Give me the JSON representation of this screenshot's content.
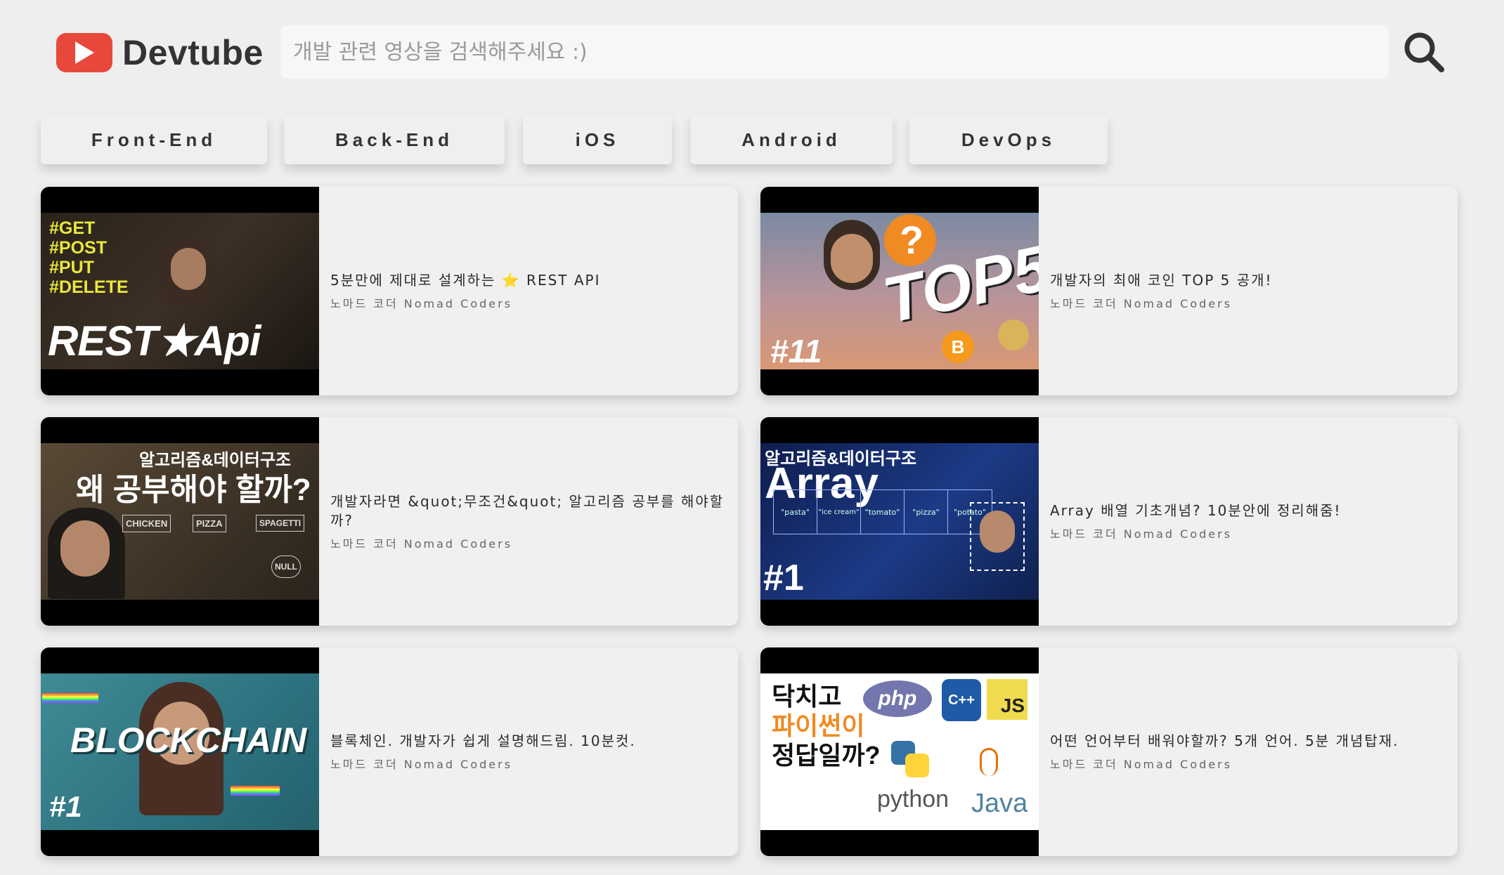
{
  "app": {
    "name": "Devtube"
  },
  "search": {
    "placeholder": "개발 관련 영상을 검색해주세요 :)",
    "value": ""
  },
  "categories": [
    "Front-End",
    "Back-End",
    "iOS",
    "Android",
    "DevOps"
  ],
  "videos": [
    {
      "title": "5분만에 제대로 설계하는 ⭐ REST API",
      "channel": "노마드 코더 Nomad Coders",
      "thumb_text": {
        "tags": "#GET\n#POST\n#PUT\n#DELETE",
        "main": "REST★Api"
      }
    },
    {
      "title": "개발자의 최애 코인 TOP 5 공개!",
      "channel": "노마드 코더 Nomad Coders",
      "thumb_text": {
        "main": "TOP5",
        "episode": "#11",
        "question": "?",
        "coin": "B"
      }
    },
    {
      "title": "개발자라면 &quot;무조건&quot; 알고리즘 공부를 해야할까?",
      "channel": "노마드 코더 Nomad Coders",
      "thumb_text": {
        "top": "알고리즘&데이터구조",
        "main": "왜 공부해야 할까?",
        "nodes": [
          "CHICKEN",
          "PIZZA",
          "SPAGETTI",
          "NULL"
        ]
      }
    },
    {
      "title": "Array 배열 기초개념? 10분안에 정리해줌!",
      "channel": "노마드 코더 Nomad Coders",
      "thumb_text": {
        "top": "알고리즘&데이터구조",
        "main": "Array",
        "cells": [
          "\"pasta\"",
          "\"ice cream\"",
          "\"tomato\"",
          "\"pizza\"",
          "\"potato\""
        ],
        "episode": "#1"
      }
    },
    {
      "title": "블록체인. 개발자가 쉽게 설명해드림. 10분컷.",
      "channel": "노마드 코더 Nomad Coders",
      "thumb_text": {
        "main": "BLOCKCHAIN",
        "episode": "#1"
      }
    },
    {
      "title": "어떤 언어부터 배워야할까? 5개 언어. 5분 개념탑재.",
      "channel": "노마드 코더 Nomad Coders",
      "thumb_text": {
        "line1": "닥치고",
        "line2": "파이썬이",
        "line3": "정답일까?",
        "php": "php",
        "cpp": "C++",
        "js": "JS",
        "python": "python",
        "java": "Java"
      }
    }
  ],
  "colors": {
    "logo_red": "#e8483b",
    "background": "#eeeeee",
    "card": "#f0f0f0"
  }
}
